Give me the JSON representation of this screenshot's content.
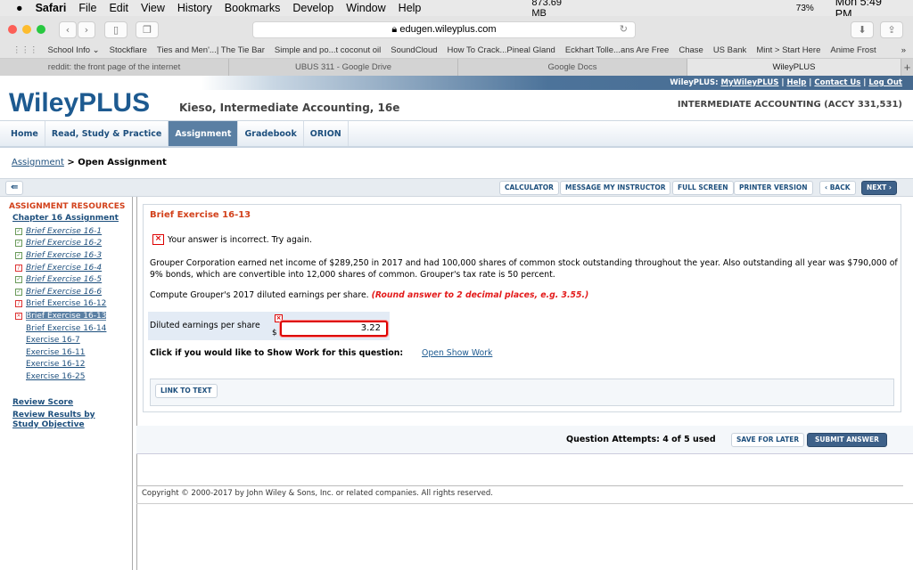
{
  "menubar": {
    "apple": "",
    "app": "Safari",
    "items": [
      "File",
      "Edit",
      "View",
      "History",
      "Bookmarks",
      "Develop",
      "Window",
      "Help"
    ],
    "memory": "873.69 MB",
    "battery": "73%",
    "clock": "Mon 5:49 PM"
  },
  "browser": {
    "url": "edugen.wileyplus.com",
    "bookmarks": [
      "School Info ⌄",
      "Stockflare",
      "Ties and Men'...| The Tie Bar",
      "Simple and po...t coconut oil",
      "SoundCloud",
      "How To Crack...Pineal Gland",
      "Eckhart Tolle...ans Are Free",
      "Chase",
      "US Bank",
      "Mint > Start Here",
      "Anime Frost"
    ],
    "tabs": [
      "reddit: the front page of the internet",
      "UBUS 311 - Google Drive",
      "Google Docs",
      "WileyPLUS"
    ]
  },
  "header": {
    "links_prefix": "WileyPLUS:",
    "links": [
      "MyWileyPLUS",
      "Help",
      "Contact Us",
      "Log Out"
    ],
    "logo": "WileyPLUS",
    "book": "Kieso, Intermediate Accounting, 16e",
    "course": "INTERMEDIATE ACCOUNTING (ACCY 331,531)"
  },
  "nav": [
    "Home",
    "Read, Study & Practice",
    "Assignment",
    "Gradebook",
    "ORION"
  ],
  "breadcrumb": {
    "link": "Assignment",
    "sep": " > ",
    "current": "Open Assignment"
  },
  "toolbar": {
    "calculator": "CALCULATOR",
    "message": "MESSAGE MY INSTRUCTOR",
    "fullscreen": "FULL SCREEN",
    "printer": "PRINTER VERSION",
    "back": "‹ BACK",
    "next": "NEXT ›"
  },
  "sidebar": {
    "heading": "ASSIGNMENT RESOURCES",
    "chapter": "Chapter 16 Assignment",
    "items": [
      {
        "label": "Brief Exercise 16-1",
        "status": "correct"
      },
      {
        "label": "Brief Exercise 16-2",
        "status": "correct"
      },
      {
        "label": "Brief Exercise 16-3",
        "status": "correct"
      },
      {
        "label": "Brief Exercise 16-4",
        "status": "partial"
      },
      {
        "label": "Brief Exercise 16-5",
        "status": "correct"
      },
      {
        "label": "Brief Exercise 16-6",
        "status": "correct"
      },
      {
        "label": "Brief Exercise 16-12",
        "status": "partial"
      },
      {
        "label": "Brief Exercise 16-13",
        "status": "incorrect"
      },
      {
        "label": "Brief Exercise 16-14",
        "status": "none"
      },
      {
        "label": "Exercise 16-7",
        "status": "none"
      },
      {
        "label": "Exercise 16-11",
        "status": "none"
      },
      {
        "label": "Exercise 16-12",
        "status": "none"
      },
      {
        "label": "Exercise 16-25",
        "status": "none"
      }
    ],
    "review_score": "Review Score",
    "review_results": "Review Results by Study Objective"
  },
  "question": {
    "title": "Brief Exercise 16-13",
    "feedback": "Your answer is incorrect.  Try again.",
    "body": "Grouper Corporation earned net income of $289,250 in 2017 and had 100,000 shares of common stock outstanding throughout the year. Also outstanding all year was $790,000 of 9% bonds, which are convertible into 12,000 shares of common. Grouper's tax rate is 50 percent.",
    "prompt": "Compute Grouper's 2017 diluted earnings per share.",
    "hint": "(Round answer to 2 decimal places, e.g. 3.55.)",
    "answer_label": "Diluted earnings per share",
    "currency": "$",
    "answer_value": "3.22",
    "show_work_label": "Click if you would like to Show Work for this question:",
    "show_work_link": "Open Show Work",
    "link_to_text": "LINK TO TEXT"
  },
  "attempts": "Question Attempts: 4 of 5 used",
  "save_later": "SAVE FOR LATER",
  "submit": "SUBMIT ANSWER",
  "copyright": "Copyright © 2000-2017 by John Wiley & Sons, Inc. or related companies. All rights reserved."
}
